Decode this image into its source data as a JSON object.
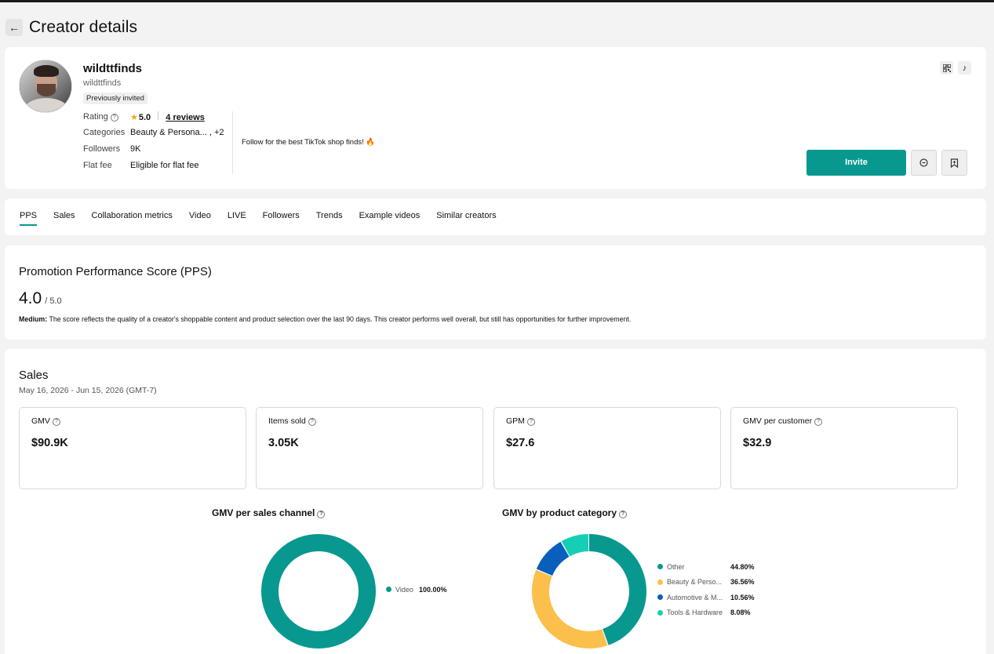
{
  "page": {
    "title": "Creator details",
    "back_icon": "arrow-left-icon"
  },
  "creator": {
    "name": "wildttfinds",
    "handle": "wildttfinds",
    "badge": "Previously invited",
    "rating_label": "Rating",
    "rating_value": "5.0",
    "reviews": "4 reviews",
    "categories_label": "Categories",
    "categories_value": "Beauty & Persona... , +2",
    "followers_label": "Followers",
    "followers_value": "9K",
    "flat_fee_label": "Flat fee",
    "flat_fee_value": "Eligible for flat fee",
    "bio": "Follow for the best TikTok shop finds! 🔥"
  },
  "actions": {
    "invite": "Invite",
    "qr_icon": "qr-code-icon",
    "tiktok_icon": "tiktok-icon",
    "message_icon": "message-icon",
    "bookmark_icon": "bookmark-add-icon"
  },
  "tabs": [
    {
      "label": "PPS",
      "active": true
    },
    {
      "label": "Sales"
    },
    {
      "label": "Collaboration metrics"
    },
    {
      "label": "Video"
    },
    {
      "label": "LIVE"
    },
    {
      "label": "Followers"
    },
    {
      "label": "Trends"
    },
    {
      "label": "Example videos"
    },
    {
      "label": "Similar creators"
    }
  ],
  "pps": {
    "title": "Promotion Performance Score (PPS)",
    "score": "4.0",
    "max": "/ 5.0",
    "level": "Medium:",
    "description": " The score reflects the quality of a creator's shoppable content and product selection over the last 90 days. This creator performs well overall, but still has opportunities for further improvement."
  },
  "sales": {
    "title": "Sales",
    "date_range": "May 16, 2026 - Jun 15, 2026 (GMT-7)",
    "metrics": [
      {
        "label": "GMV",
        "value": "$90.9K"
      },
      {
        "label": "Items sold",
        "value": "3.05K"
      },
      {
        "label": "GPM",
        "value": "$27.6"
      },
      {
        "label": "GMV per customer",
        "value": "$32.9"
      }
    ]
  },
  "colors": {
    "accent": "#089890",
    "yellow": "#fbbf4b",
    "blue": "#0a5fbd",
    "cyan": "#15cfb5"
  },
  "chart_data": [
    {
      "type": "pie",
      "title": "GMV per sales channel",
      "categories": [
        "Video"
      ],
      "values": [
        100.0
      ],
      "labels": [
        "100.00%"
      ],
      "colors": [
        "#089890"
      ],
      "legend": "right"
    },
    {
      "type": "pie",
      "title": "GMV by product category",
      "categories": [
        "Other",
        "Beauty & Perso...",
        "Automotive & M...",
        "Tools & Hardware"
      ],
      "values": [
        44.8,
        36.56,
        10.56,
        8.08
      ],
      "labels": [
        "44.80%",
        "36.56%",
        "10.56%",
        "8.08%"
      ],
      "colors": [
        "#089890",
        "#fbbf4b",
        "#0a5fbd",
        "#15cfb5"
      ],
      "legend": "right"
    }
  ]
}
